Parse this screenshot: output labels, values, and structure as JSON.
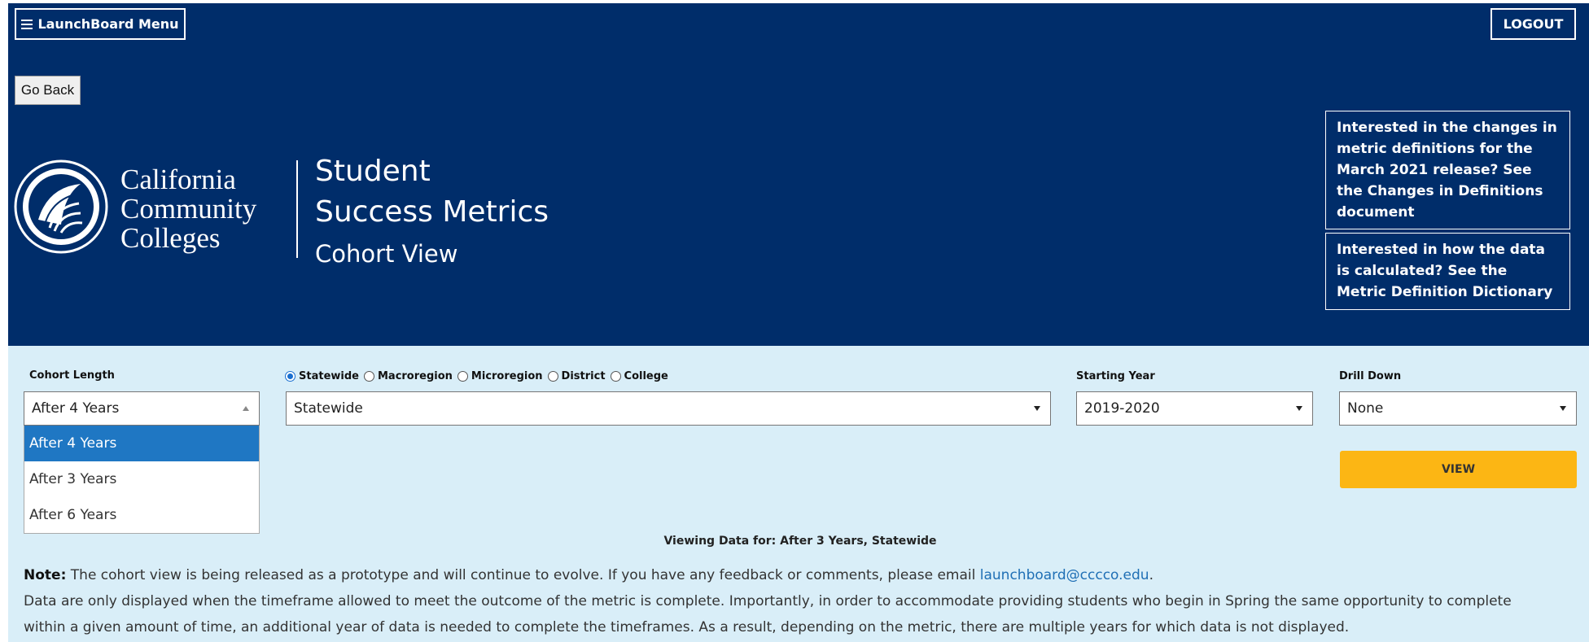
{
  "header": {
    "menu_label": "LaunchBoard Menu",
    "logout_label": "LOGOUT",
    "go_back_label": "Go Back",
    "logo_lines": [
      "California",
      "Community",
      "Colleges"
    ],
    "title_line1": "Student",
    "title_line2": "Success Metrics",
    "subtitle": "Cohort View",
    "info_box_1": "Interested in the changes in metric definitions for the March 2021 release? See the Changes in Definitions document",
    "info_box_2": "Interested in how the data is calculated? See the Metric Definition Dictionary"
  },
  "filters": {
    "cohort_length_label": "Cohort Length",
    "cohort_length_value": "After 4 Years",
    "cohort_length_options": [
      "After 4 Years",
      "After 3 Years",
      "After 6 Years"
    ],
    "geo_options": [
      "Statewide",
      "Macroregion",
      "Microregion",
      "District",
      "College"
    ],
    "geo_selected": "Statewide",
    "geo_value": "Statewide",
    "starting_year_label": "Starting Year",
    "starting_year_value": "2019-2020",
    "drill_down_label": "Drill Down",
    "drill_down_value": "None",
    "view_label": "VIEW"
  },
  "status": {
    "viewing_text": "Viewing Data for: After 3 Years, Statewide"
  },
  "notes": {
    "note_label": "Note:",
    "note_text": " The cohort view is being released as a prototype and will continue to evolve. If you have any feedback or comments, please email ",
    "email": "launchboard@cccco.edu",
    "note_end": ".",
    "data_line1": "Data are only displayed when the timeframe allowed to meet the outcome of the metric is complete. Importantly, in order to accommodate providing students who begin in Spring the same opportunity to complete",
    "data_line2": "within a given amount of time, an additional year of data is needed to complete the timeframes. As a result, depending on the metric, there are multiple years for which data is not displayed."
  },
  "colors": {
    "header_bg": "#002d6a",
    "filter_bg": "#d9eef8",
    "view_button": "#fcb614",
    "selected_option": "#1f77c3",
    "link": "#1f6fb5"
  }
}
